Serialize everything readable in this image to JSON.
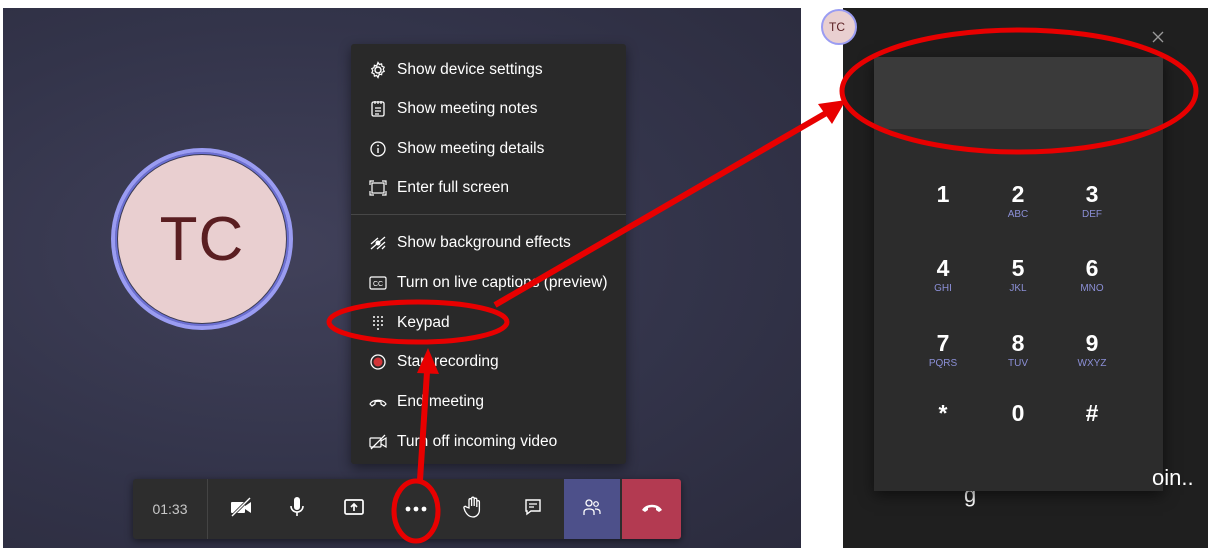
{
  "call": {
    "avatar_initials": "TC",
    "timer": "01:33"
  },
  "menu": {
    "items": [
      {
        "label": "Show device settings",
        "icon": "gear-icon"
      },
      {
        "label": "Show meeting notes",
        "icon": "notes-icon"
      },
      {
        "label": "Show meeting details",
        "icon": "info-icon"
      },
      {
        "label": "Enter full screen",
        "icon": "fullscreen-icon"
      },
      {
        "label": "Show background effects",
        "icon": "background-effects-icon"
      },
      {
        "label": "Turn on live captions (preview)",
        "icon": "captions-icon"
      },
      {
        "label": "Keypad",
        "icon": "keypad-icon"
      },
      {
        "label": "Start recording",
        "icon": "record-icon"
      },
      {
        "label": "End meeting",
        "icon": "end-meeting-icon"
      },
      {
        "label": "Turn off incoming video",
        "icon": "video-off-icon"
      }
    ]
  },
  "controlbar": {
    "buttons": [
      "camera-off-icon",
      "microphone-icon",
      "share-screen-icon",
      "more-actions-icon",
      "raise-hand-icon",
      "chat-icon",
      "participants-icon",
      "hang-up-icon"
    ]
  },
  "keypad": {
    "mini_avatar": "TC",
    "keys": [
      {
        "digit": "1",
        "letters": ""
      },
      {
        "digit": "2",
        "letters": "ABC"
      },
      {
        "digit": "3",
        "letters": "DEF"
      },
      {
        "digit": "4",
        "letters": "GHI"
      },
      {
        "digit": "5",
        "letters": "JKL"
      },
      {
        "digit": "6",
        "letters": "MNO"
      },
      {
        "digit": "7",
        "letters": "PQRS"
      },
      {
        "digit": "8",
        "letters": "TUV"
      },
      {
        "digit": "9",
        "letters": "WXYZ"
      },
      {
        "digit": "*",
        "letters": ""
      },
      {
        "digit": "0",
        "letters": ""
      },
      {
        "digit": "#",
        "letters": ""
      }
    ],
    "status_tail": "oin..",
    "status_fragment": "g"
  },
  "colors": {
    "annotation_red": "#e80000",
    "accent": "#6264a7",
    "hangup": "#b33a51"
  }
}
